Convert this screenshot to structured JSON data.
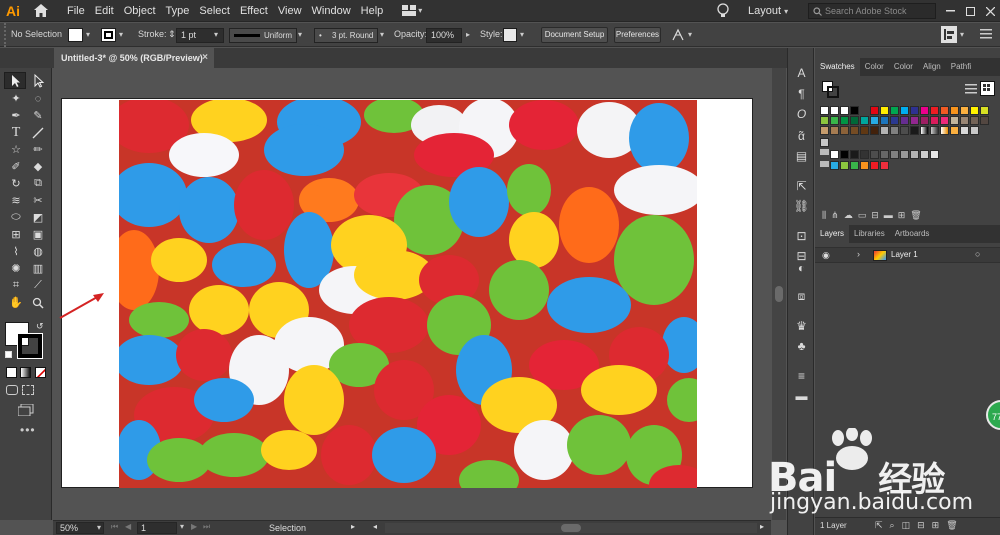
{
  "app": {
    "logo": "Ai"
  },
  "menu": [
    "File",
    "Edit",
    "Object",
    "Type",
    "Select",
    "Effect",
    "View",
    "Window",
    "Help"
  ],
  "workspace": "Layout",
  "stock_search_placeholder": "Search Adobe Stock",
  "control": {
    "selection": "No Selection",
    "stroke_label": "Stroke:",
    "stroke_value": "1 pt",
    "stroke_profile": "Uniform",
    "brush": "3 pt. Round",
    "opacity_label": "Opacity:",
    "opacity_value": "100%",
    "style_label": "Style:",
    "doc_setup": "Document Setup",
    "preferences": "Preferences"
  },
  "document_tab": {
    "title": "Untitled-3* @ 50% (RGB/Preview)",
    "close": "×"
  },
  "status": {
    "zoom": "50%",
    "artboard": "1",
    "mode": "Selection"
  },
  "panels": {
    "top_tabs": [
      "Swatches",
      "Color",
      "Color",
      "Align",
      "Pathfi"
    ],
    "layer_tabs": [
      "Layers",
      "Libraries",
      "Artboards"
    ],
    "layer_name": "Layer 1",
    "layer_count": "1 Layer"
  },
  "watermark": {
    "brand": "Bai",
    "brand2": "经验",
    "url": "jingyan.baidu.com"
  },
  "badge": "77",
  "colors": {
    "menubar": "#323232",
    "panel": "#424242",
    "canvas": "#535353",
    "accent_arrow": "#d42323"
  }
}
